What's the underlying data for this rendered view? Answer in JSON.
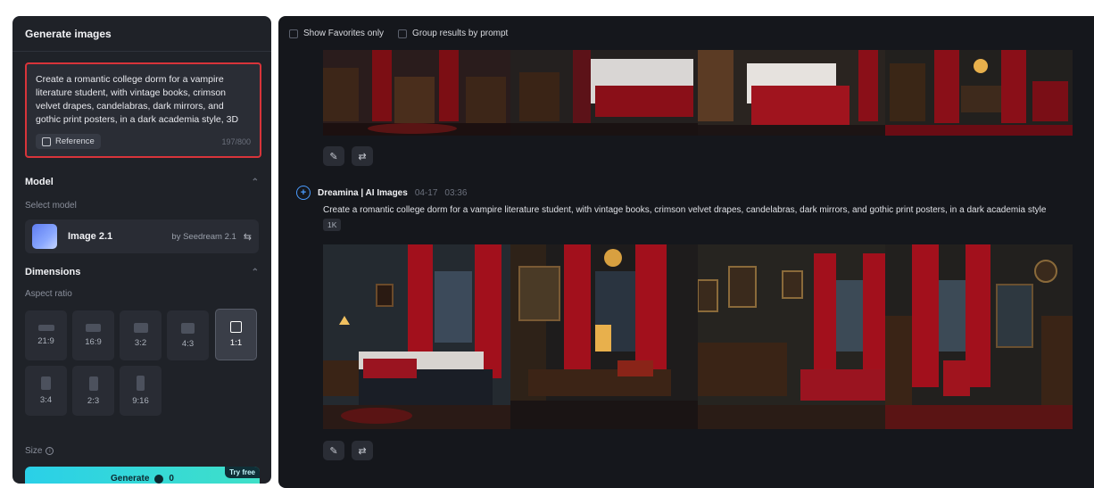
{
  "left_panel": {
    "title": "Generate images",
    "prompt_text": "Create a romantic college dorm for a vampire literature student, with vintage books, crimson velvet drapes, candelabras, dark mirrors, and gothic print posters, in a dark academia style, 3D",
    "reference_label": "Reference",
    "char_count": "197/800",
    "model_section": "Model",
    "select_model_label": "Select model",
    "model_name": "Image 2.1",
    "model_by": "by Seedream 2.1",
    "dimensions_section": "Dimensions",
    "aspect_ratio_label": "Aspect ratio",
    "ratios": [
      "21:9",
      "16:9",
      "3:2",
      "4:3",
      "1:1",
      "3:4",
      "2:3",
      "9:16"
    ],
    "selected_ratio": "1:1",
    "size_label": "Size",
    "generate_label": "Generate",
    "credits": "0",
    "try_free": "Try free"
  },
  "results": {
    "filter_favorites": "Show Favorites only",
    "filter_group": "Group results by prompt",
    "entry": {
      "name": "Dreamina | AI Images",
      "date": "04-17",
      "time": "03:36",
      "prompt": "Create a romantic college dorm for a vampire literature student, with vintage books, crimson velvet drapes, candelabras, dark mirrors, and gothic print posters, in a dark academia style",
      "resolution": "1K"
    }
  },
  "colors": {
    "accent_red": "#d8343a",
    "accent_cyan": "#2ad0e8",
    "panel_bg": "#1f2228",
    "results_bg": "#15171c"
  }
}
